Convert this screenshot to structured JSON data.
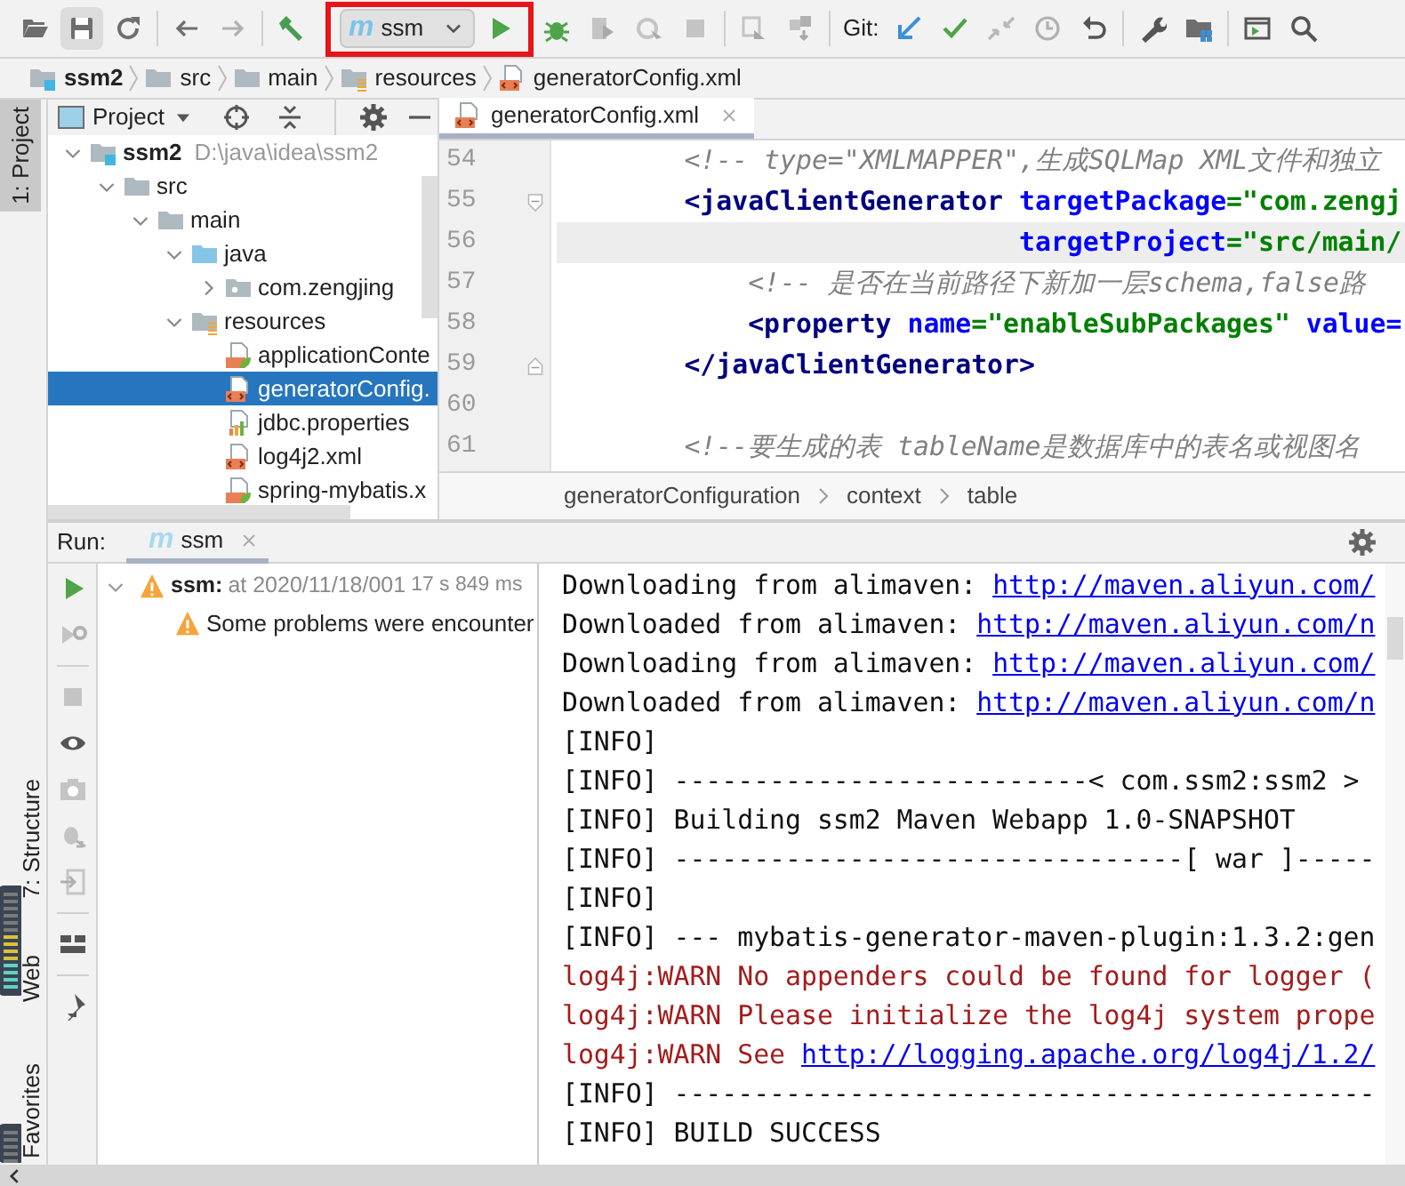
{
  "toolbar": {
    "run_config": "ssm",
    "run_config_glyph": "m",
    "git_label": "Git:"
  },
  "breadcrumb": [
    {
      "label": "ssm2",
      "kind": "module"
    },
    {
      "label": "src",
      "kind": "folder"
    },
    {
      "label": "main",
      "kind": "folder"
    },
    {
      "label": "resources",
      "kind": "resource-folder"
    },
    {
      "label": "generatorConfig.xml",
      "kind": "xml"
    }
  ],
  "tool_stripe": [
    {
      "label": "1: Project",
      "kind": "top",
      "selected": true
    },
    {
      "label": "7: Structure",
      "kind": "bottom",
      "selected": false
    },
    {
      "label": "Web",
      "kind": "bottom",
      "selected": false
    },
    {
      "label": "Favorites",
      "kind": "bottom",
      "selected": false
    }
  ],
  "project_panel": {
    "title": "Project",
    "tree": [
      {
        "label": "ssm2",
        "path": "D:\\java\\idea\\ssm2",
        "kind": "module",
        "expanded": true,
        "selected": false,
        "children": [
          {
            "label": "src",
            "kind": "folder",
            "expanded": true,
            "selected": false,
            "children": [
              {
                "label": "main",
                "kind": "folder",
                "expanded": true,
                "selected": false,
                "children": [
                  {
                    "label": "java",
                    "kind": "source-folder",
                    "expanded": true,
                    "selected": false,
                    "children": [
                      {
                        "label": "com.zengjing",
                        "kind": "package",
                        "expanded": false,
                        "selected": false
                      }
                    ]
                  },
                  {
                    "label": "resources",
                    "kind": "resource-folder",
                    "expanded": true,
                    "selected": false,
                    "children": [
                      {
                        "label": "applicationConte",
                        "kind": "spring-xml",
                        "selected": false
                      },
                      {
                        "label": "generatorConfig.",
                        "kind": "xml",
                        "selected": true
                      },
                      {
                        "label": "jdbc.properties",
                        "kind": "properties",
                        "selected": false
                      },
                      {
                        "label": "log4j2.xml",
                        "kind": "xml",
                        "selected": false
                      },
                      {
                        "label": "spring-mybatis.x",
                        "kind": "spring-xml",
                        "selected": false
                      }
                    ]
                  }
                ]
              }
            ]
          }
        ]
      }
    ]
  },
  "editor": {
    "tabs": [
      {
        "label": "generatorConfig.xml",
        "selected": true
      }
    ],
    "lines": [
      {
        "number": "54",
        "current": false,
        "fold_start": false,
        "fold_end": false,
        "segments": [
          {
            "kind": "comment",
            "text": "        <!-- type=\"XMLMAPPER\",生成SQLMap XML文件和独立"
          }
        ]
      },
      {
        "number": "55",
        "current": false,
        "fold_start": true,
        "fold_end": false,
        "segments": [
          {
            "kind": "tag",
            "text": "        <javaClientGenerator "
          },
          {
            "kind": "attr",
            "text": "targetPackage"
          },
          {
            "kind": "value",
            "text": "=\"com.zengj"
          }
        ]
      },
      {
        "number": "56",
        "current": true,
        "fold_start": false,
        "fold_end": false,
        "segments": [
          {
            "kind": "attr",
            "text": "                             targetProject"
          },
          {
            "kind": "value",
            "text": "=\"src/main/"
          }
        ]
      },
      {
        "number": "57",
        "current": false,
        "fold_start": false,
        "fold_end": false,
        "segments": [
          {
            "kind": "comment",
            "text": "            <!-- 是否在当前路径下新加一层schema,false路"
          }
        ]
      },
      {
        "number": "58",
        "current": false,
        "fold_start": false,
        "fold_end": false,
        "segments": [
          {
            "kind": "tag",
            "text": "            <property "
          },
          {
            "kind": "attr",
            "text": "name"
          },
          {
            "kind": "value",
            "text": "=\"enableSubPackages\" "
          },
          {
            "kind": "attr",
            "text": "value="
          }
        ]
      },
      {
        "number": "59",
        "current": false,
        "fold_start": false,
        "fold_end": true,
        "segments": [
          {
            "kind": "tag",
            "text": "        </javaClientGenerator>"
          }
        ]
      },
      {
        "number": "60",
        "current": false,
        "fold_start": false,
        "fold_end": false
      },
      {
        "number": "61",
        "current": false,
        "fold_start": false,
        "fold_end": false,
        "segments": [
          {
            "kind": "comment",
            "text": "        <!--要生成的表 tableName是数据库中的表名或视图名"
          }
        ]
      }
    ],
    "breadcrumb": [
      "generatorConfiguration",
      "context",
      "table"
    ]
  },
  "run_panel": {
    "label": "Run:",
    "tabs": [
      {
        "label": "ssm",
        "glyph": "m",
        "selected": true
      }
    ],
    "tree": [
      {
        "name": "ssm:",
        "detail": "at 2020/11/18/001",
        "time": "17 s 849 ms",
        "expanded": true,
        "children": [
          {
            "name": "Some problems were encounter"
          }
        ]
      }
    ],
    "console": [
      {
        "kind": "info",
        "segments": [
          {
            "kind": "text",
            "text": "Downloading from alimaven: "
          },
          {
            "kind": "link",
            "text": "http://maven.aliyun.com/"
          }
        ]
      },
      {
        "kind": "info",
        "segments": [
          {
            "kind": "text",
            "text": "Downloaded from alimaven: "
          },
          {
            "kind": "link",
            "text": "http://maven.aliyun.com/n"
          }
        ]
      },
      {
        "kind": "info",
        "segments": [
          {
            "kind": "text",
            "text": "Downloading from alimaven: "
          },
          {
            "kind": "link",
            "text": "http://maven.aliyun.com/"
          }
        ]
      },
      {
        "kind": "info",
        "segments": [
          {
            "kind": "text",
            "text": "Downloaded from alimaven: "
          },
          {
            "kind": "link",
            "text": "http://maven.aliyun.com/n"
          }
        ]
      },
      {
        "kind": "info",
        "segments": [
          {
            "kind": "text",
            "text": "[INFO]"
          }
        ]
      },
      {
        "kind": "info",
        "segments": [
          {
            "kind": "text",
            "text": "[INFO] --------------------------< com.ssm2:ssm2 >"
          }
        ]
      },
      {
        "kind": "info",
        "segments": [
          {
            "kind": "text",
            "text": "[INFO] Building ssm2 Maven Webapp 1.0-SNAPSHOT"
          }
        ]
      },
      {
        "kind": "info",
        "segments": [
          {
            "kind": "text",
            "text": "[INFO] --------------------------------[ war ]-----"
          }
        ]
      },
      {
        "kind": "info",
        "segments": [
          {
            "kind": "text",
            "text": "[INFO]"
          }
        ]
      },
      {
        "kind": "info",
        "segments": [
          {
            "kind": "text",
            "text": "[INFO] --- mybatis-generator-maven-plugin:1.3.2:gen"
          }
        ]
      },
      {
        "kind": "warn",
        "segments": [
          {
            "kind": "text",
            "text": "log4j:WARN No appenders could be found for logger ("
          }
        ]
      },
      {
        "kind": "warn",
        "segments": [
          {
            "kind": "text",
            "text": "log4j:WARN Please initialize the log4j system prope"
          }
        ]
      },
      {
        "kind": "warn",
        "segments": [
          {
            "kind": "text",
            "text": "log4j:WARN See "
          },
          {
            "kind": "link",
            "text": "http://logging.apache.org/log4j/1.2/"
          }
        ]
      },
      {
        "kind": "info",
        "segments": [
          {
            "kind": "text",
            "text": "[INFO] --------------------------------------------"
          }
        ]
      },
      {
        "kind": "info",
        "segments": [
          {
            "kind": "text",
            "text": "[INFO] BUILD SUCCESS"
          }
        ]
      }
    ]
  }
}
